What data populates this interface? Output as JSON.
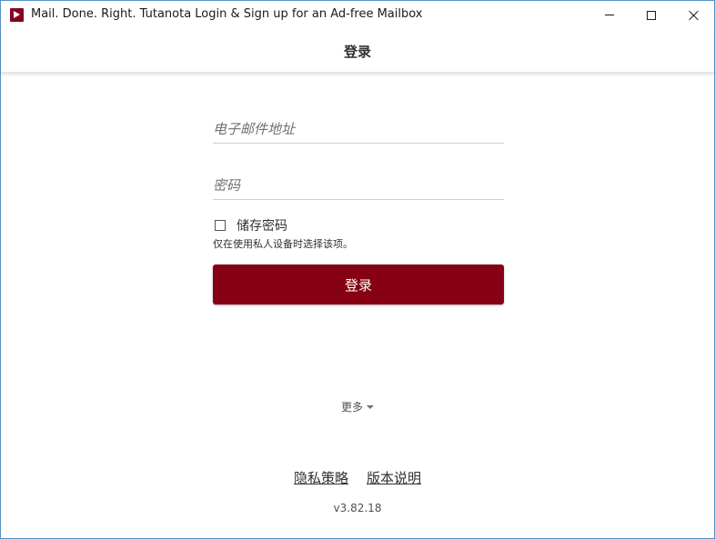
{
  "window": {
    "title": "Mail. Done. Right. Tutanota Login & Sign up for an Ad-free Mailbox"
  },
  "header": {
    "title": "登录"
  },
  "form": {
    "email_placeholder": "电子邮件地址",
    "password_placeholder": "密码",
    "save_password_label": "储存密码",
    "save_password_help": "仅在使用私人设备时选择该项。",
    "login_button_label": "登录"
  },
  "more": {
    "label": "更多"
  },
  "footer": {
    "privacy_label": "隐私策略",
    "release_notes_label": "版本说明",
    "version": "v3.82.18"
  },
  "colors": {
    "accent": "#850113",
    "window_border": "#5a8fc7"
  },
  "icons": {
    "app": "tutanota-logo-icon",
    "more_caret": "caret-down-icon"
  }
}
